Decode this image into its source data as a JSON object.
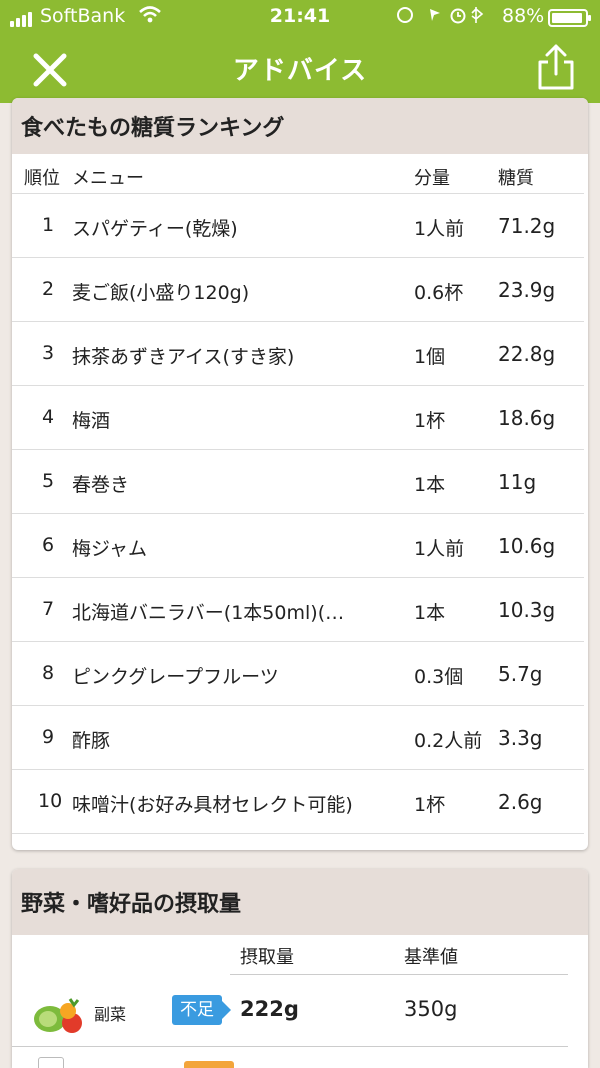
{
  "status_bar": {
    "carrier": "SoftBank",
    "time": "21:41",
    "battery": "88%"
  },
  "nav": {
    "title": "アドバイス"
  },
  "ranking": {
    "title": "食べたもの糖質ランキング",
    "headers": {
      "rank": "順位",
      "menu": "メニュー",
      "amount": "分量",
      "carb": "糖質"
    },
    "rows": [
      {
        "rank": "1",
        "menu": "スパゲティー(乾燥)",
        "amount": "1人前",
        "carb": "71.2g"
      },
      {
        "rank": "2",
        "menu": "麦ご飯(小盛り120g)",
        "amount": "0.6杯",
        "carb": "23.9g"
      },
      {
        "rank": "3",
        "menu": "抹茶あずきアイス(すき家)",
        "amount": "1個",
        "carb": "22.8g"
      },
      {
        "rank": "4",
        "menu": "梅酒",
        "amount": "1杯",
        "carb": "18.6g"
      },
      {
        "rank": "5",
        "menu": "春巻き",
        "amount": "1本",
        "carb": "11g"
      },
      {
        "rank": "6",
        "menu": "梅ジャム",
        "amount": "1人前",
        "carb": "10.6g"
      },
      {
        "rank": "7",
        "menu": "北海道バニラバー(1本50ml)(…",
        "amount": "1本",
        "carb": "10.3g"
      },
      {
        "rank": "8",
        "menu": "ピンクグレープフルーツ",
        "amount": "0.3個",
        "carb": "5.7g"
      },
      {
        "rank": "9",
        "menu": "酢豚",
        "amount": "0.2人前",
        "carb": "3.3g"
      },
      {
        "rank": "10",
        "menu": "味噌汁(お好み具材セレクト可能)",
        "amount": "1杯",
        "carb": "2.6g"
      }
    ]
  },
  "intake": {
    "title": "野菜・嗜好品の摂取量",
    "headers": {
      "intake": "摂取量",
      "standard": "基準値"
    },
    "rows": [
      {
        "label": "副菜",
        "status": "不足",
        "intake": "222g",
        "standard": "350g",
        "icon": "vegetables-icon"
      }
    ]
  },
  "colors": {
    "header_green": "#8dbb32",
    "badge_blue": "#3a9be0",
    "section_bg": "#e6ddd8"
  }
}
